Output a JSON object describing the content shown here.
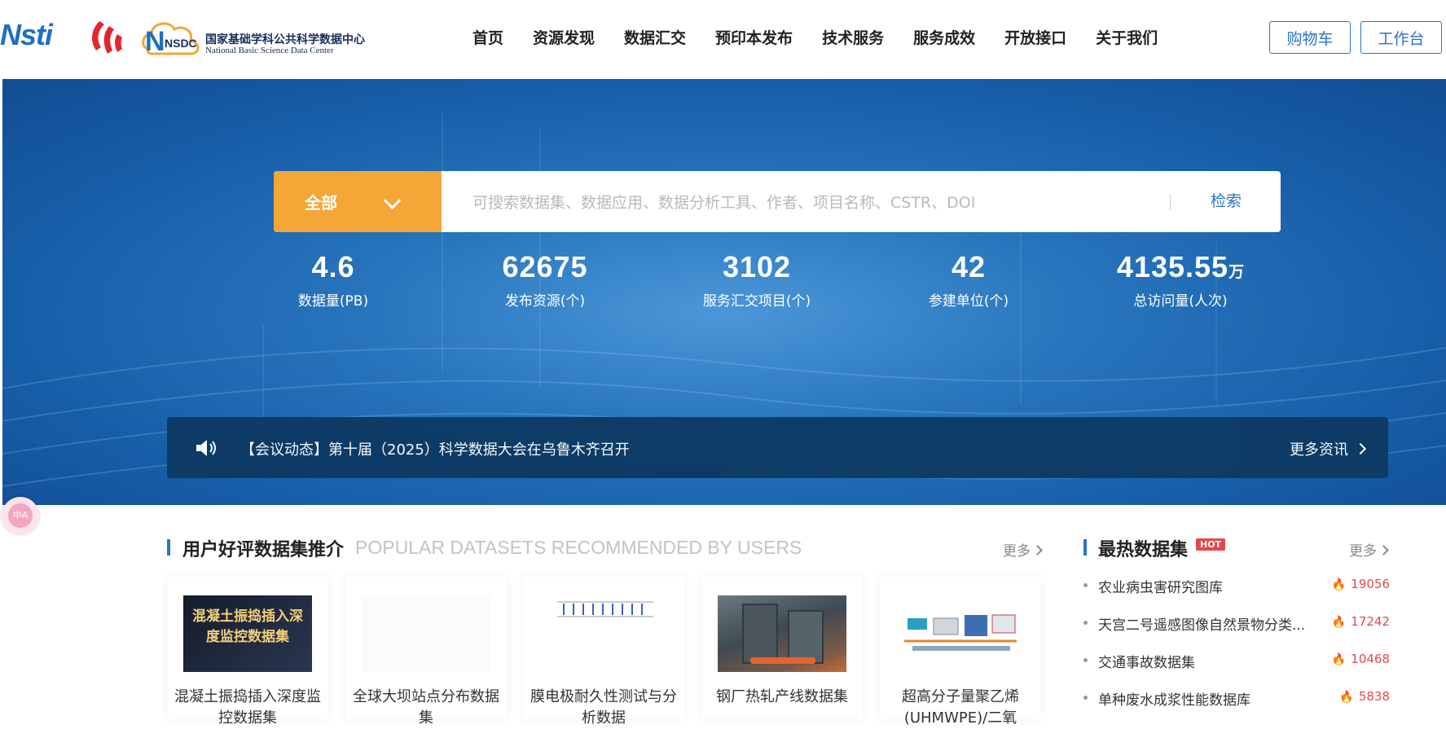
{
  "header": {
    "logo_nsti": "Nsti",
    "logo_cn": "国家基础学科公共科学数据中心",
    "logo_en": "National Basic Science Data Center",
    "logo_nsdc_mark": "NSDC",
    "nav": [
      "首页",
      "资源发现",
      "数据汇交",
      "预印本发布",
      "技术服务",
      "服务成效",
      "开放接口",
      "关于我们"
    ],
    "cart_label": "购物车",
    "workbench_label": "工作台"
  },
  "search": {
    "category": "全部",
    "placeholder": "可搜索数据集、数据应用、数据分析工具、作者、项目名称、CSTR、DOI",
    "button": "检索"
  },
  "stats": [
    {
      "value": "4.6",
      "unit": "",
      "label": "数据量(PB)"
    },
    {
      "value": "62675",
      "unit": "",
      "label": "发布资源(个)"
    },
    {
      "value": "3102",
      "unit": "",
      "label": "服务汇交项目(个)"
    },
    {
      "value": "42",
      "unit": "",
      "label": "参建单位(个)"
    },
    {
      "value": "4135.55",
      "unit": "万",
      "label": "总访问量(人次)"
    }
  ],
  "news": {
    "text": "【会议动态】第十届（2025）科学数据大会在乌鲁木齐召开",
    "more": "更多资讯"
  },
  "translate_badge": "中A",
  "popular": {
    "title": "用户好评数据集推介",
    "subtitle": "POPULAR DATASETS RECOMMENDED BY USERS",
    "more": "更多",
    "cover_text": "混凝土振捣插入深度监控数据集",
    "cards": [
      {
        "title": "混凝土振捣插入深度监控数据集"
      },
      {
        "title": "全球大坝站点分布数据集"
      },
      {
        "title": "膜电极耐久性测试与分析数据"
      },
      {
        "title": "钢厂热轧产线数据集"
      },
      {
        "title": "超高分子量聚乙烯(UHMWPE)/二氧"
      }
    ]
  },
  "hot": {
    "title": "最热数据集",
    "badge": "HOT",
    "more": "更多",
    "items": [
      {
        "name": "农业病虫害研究图库",
        "count": "19056"
      },
      {
        "name": "天宫二号遥感图像自然景物分类...",
        "count": "17242"
      },
      {
        "name": "交通事故数据集",
        "count": "10468"
      },
      {
        "name": "单种废水成浆性能数据库",
        "count": "5838"
      }
    ]
  },
  "colors": {
    "accent": "#2a74c9",
    "search_category": "#f4a637",
    "hot": "#e5484d",
    "hero": "#1f66b0"
  }
}
